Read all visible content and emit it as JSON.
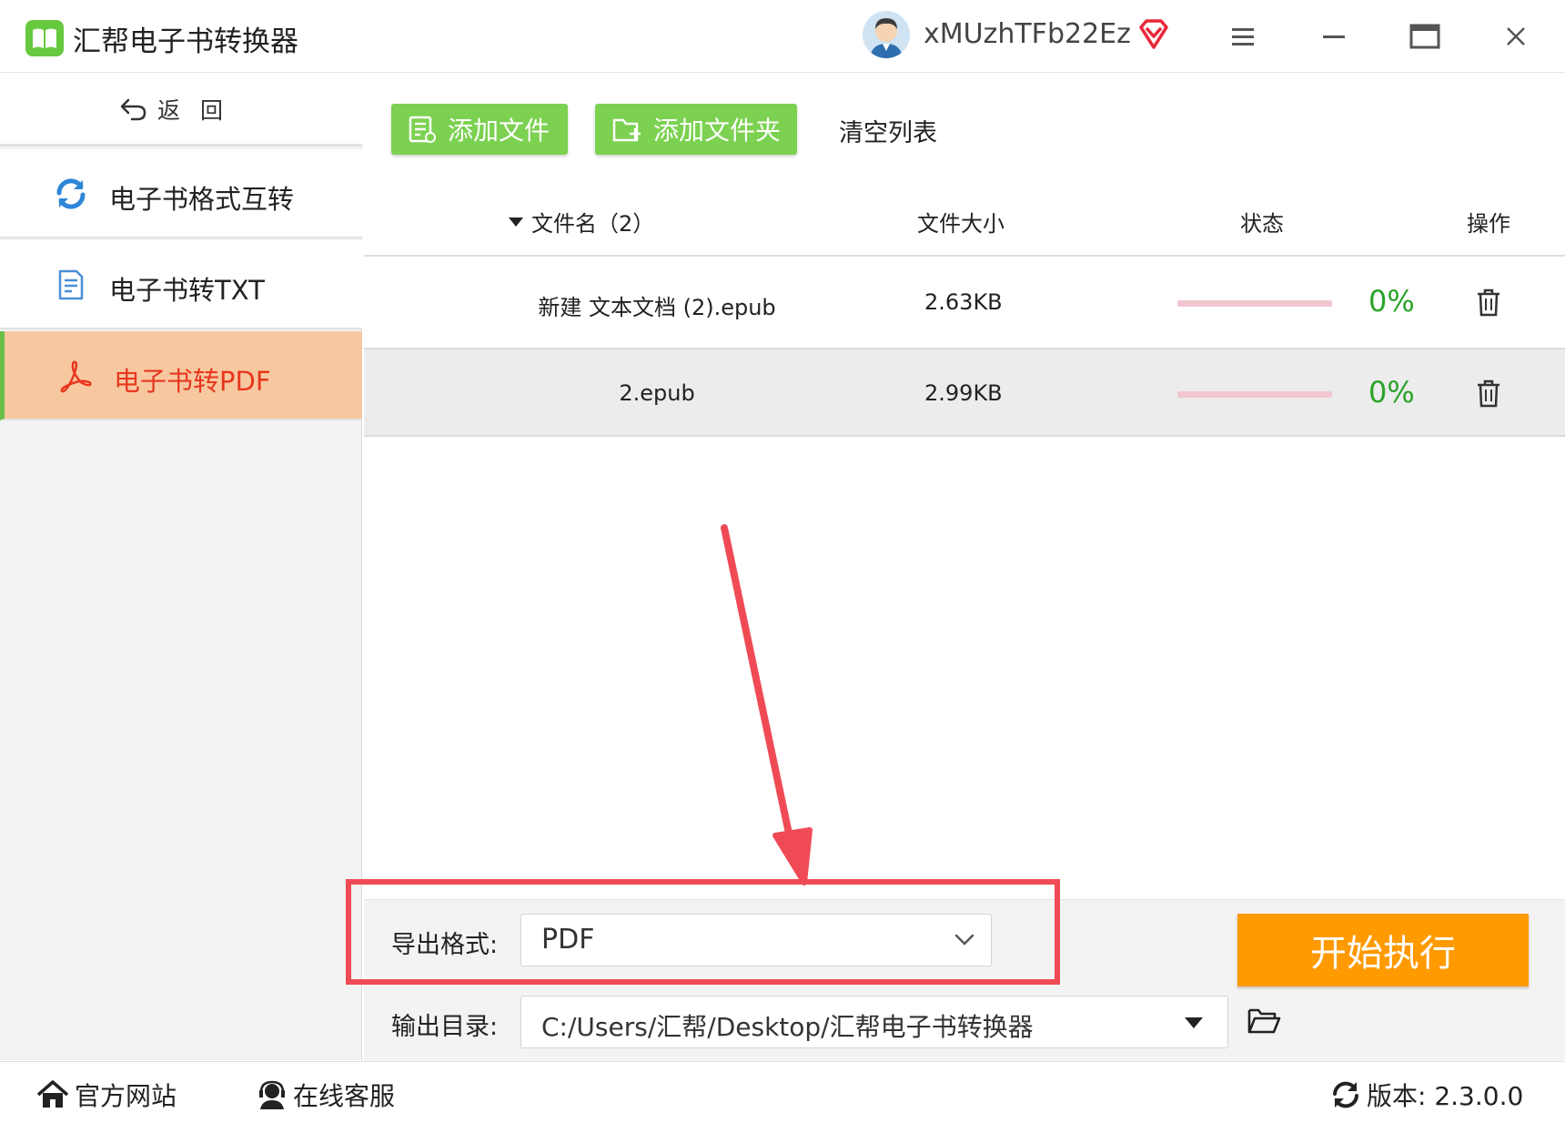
{
  "app": {
    "title": "汇帮电子书转换器",
    "username": "xMUzhTFb22Ez"
  },
  "sidebar": {
    "back_label": "返回",
    "items": [
      {
        "label": "电子书格式互转",
        "icon": "sync-icon"
      },
      {
        "label": "电子书转TXT",
        "icon": "document-icon"
      },
      {
        "label": "电子书转PDF",
        "icon": "pdf-icon",
        "active": true
      }
    ]
  },
  "toolbar": {
    "add_file": "添加文件",
    "add_folder": "添加文件夹",
    "clear_list": "清空列表"
  },
  "table": {
    "headers": {
      "filename": "文件名（2）",
      "size": "文件大小",
      "status": "状态",
      "action": "操作"
    },
    "rows": [
      {
        "name": "新建 文本文档 (2).epub",
        "size": "2.63KB",
        "progress_text": "0%",
        "progress": 0
      },
      {
        "name": "2.epub",
        "size": "2.99KB",
        "progress_text": "0%",
        "progress": 0
      }
    ]
  },
  "export": {
    "format_label": "导出格式:",
    "format_value": "PDF",
    "output_label": "输出目录:",
    "output_value": "C:/Users/汇帮/Desktop/汇帮电子书转换器",
    "start_label": "开始执行"
  },
  "footer": {
    "website": "官方网站",
    "support": "在线客服",
    "version_label": "版本: 2.3.0.0"
  },
  "colors": {
    "accent_green": "#7cd151",
    "active_bg": "#f7c8a0",
    "active_text": "#e8361e",
    "start_orange": "#ff9a00",
    "progress_green": "#2aa32a",
    "annotation_red": "#f04b55"
  }
}
